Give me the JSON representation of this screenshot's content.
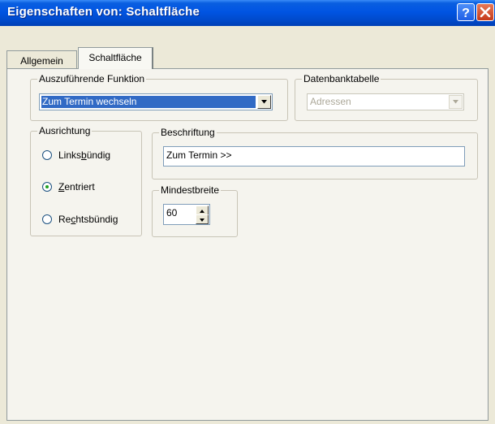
{
  "window": {
    "title": "Eigenschaften von: Schaltfläche"
  },
  "title_buttons": {
    "help": "?",
    "close": "X"
  },
  "tabs": [
    {
      "label": "Allgemein",
      "active": false
    },
    {
      "label": "Schaltfläche",
      "active": true
    }
  ],
  "function_group": {
    "legend": "Auszuführende Funktion",
    "selected": "Zum Termin wechseln"
  },
  "table_group": {
    "legend": "Datenbanktabelle",
    "selected": "Adressen",
    "enabled": false
  },
  "alignment_group": {
    "legend": "Ausrichtung",
    "options": [
      {
        "before": "Links",
        "accel": "b",
        "after": "ündig",
        "checked": false
      },
      {
        "before": "",
        "accel": "Z",
        "after": "entriert",
        "checked": true
      },
      {
        "before": "Re",
        "accel": "c",
        "after": "htsbündig",
        "checked": false
      }
    ]
  },
  "caption_group": {
    "legend": "Beschriftung",
    "value": "Zum Termin >>"
  },
  "minwidth_group": {
    "legend": "Mindestbreite",
    "value": "60"
  },
  "colors": {
    "title_bar": "#0054e3",
    "selection": "#316ac5",
    "close_button": "#c5391a",
    "radio_dot": "#21a121"
  }
}
